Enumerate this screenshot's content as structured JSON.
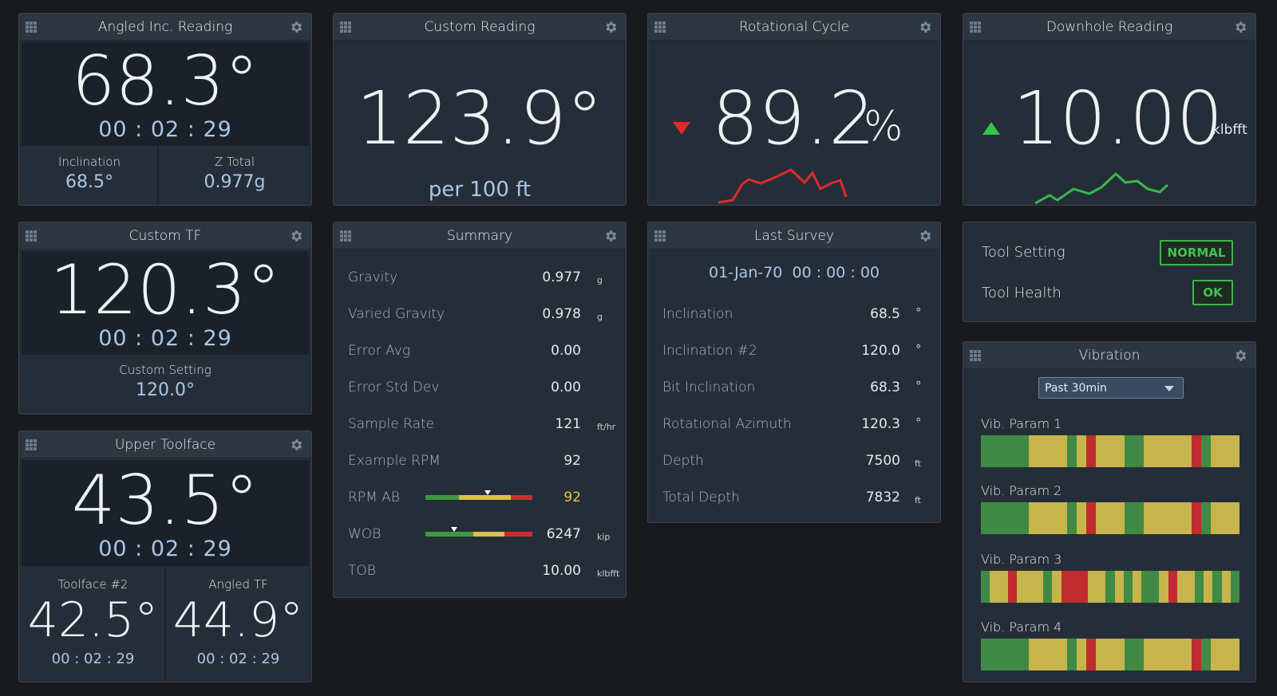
{
  "colors": {
    "green": "#3f8a45",
    "yellow": "#c8b44c",
    "red": "#c02c2f",
    "accent_timer": "#a9c6e6"
  },
  "icons": {
    "grip": "grip-icon",
    "gear": "gear-icon",
    "down": "down-triangle-icon",
    "up": "up-triangle-icon"
  },
  "angled_inc": {
    "title": "Angled Inc. Reading",
    "value": "68.3°",
    "timer": "00 : 02 : 29",
    "left_label": "Inclination",
    "left_value": "68.5°",
    "right_label": "Z Total",
    "right_value": "0.977g"
  },
  "custom_reading": {
    "title": "Custom Reading",
    "value": "123.9°",
    "unit": "per 100 ft"
  },
  "rotational": {
    "title": "Rotational Cycle",
    "value": "89.2",
    "unit": "%",
    "trend": "down"
  },
  "downhole": {
    "title": "Downhole Reading",
    "value": "10.00",
    "unit": "klbfft",
    "trend": "up"
  },
  "custom_tf": {
    "title": "Custom TF",
    "value": "120.3°",
    "timer": "00 : 02 : 29",
    "setting_label": "Custom Setting",
    "setting_value": "120.0°"
  },
  "upper_tf": {
    "title": "Upper Toolface",
    "value": "43.5°",
    "timer": "00 : 02 : 29",
    "left_label": "Toolface #2",
    "left_value": "42.5°",
    "left_timer": "00 : 02 : 29",
    "right_label": "Angled TF",
    "right_value": "44.9°",
    "right_timer": "00 : 02 : 29"
  },
  "summary": {
    "title": "Summary",
    "rows": [
      {
        "label": "Gravity",
        "value": "0.977",
        "unit": "g"
      },
      {
        "label": "Varied Gravity",
        "value": "0.978",
        "unit": "g"
      },
      {
        "label": "Error Avg",
        "value": "0.00",
        "unit": ""
      },
      {
        "label": "Error Std Dev",
        "value": "0.00",
        "unit": ""
      },
      {
        "label": "Sample Rate",
        "value": "121",
        "unit": "ft/hr"
      },
      {
        "label": "Example RPM",
        "value": "92",
        "unit": ""
      },
      {
        "label": "RPM AB",
        "value": "92",
        "unit": "",
        "gauge_level": 0.58
      },
      {
        "label": "WOB",
        "value": "6247",
        "unit": "kip",
        "gauge_level": 0.27
      },
      {
        "label": "TOB",
        "value": "10.00",
        "unit": "klbfft"
      }
    ]
  },
  "last_survey": {
    "title": "Last Survey",
    "date": "01-Jan-70",
    "time": "00 : 00 : 00",
    "rows": [
      {
        "label": "Inclination",
        "value": "68.5",
        "unit": "°"
      },
      {
        "label": "Inclination #2",
        "value": "120.0",
        "unit": "°"
      },
      {
        "label": "Bit Inclination",
        "value": "68.3",
        "unit": "°"
      },
      {
        "label": "Rotational Azimuth",
        "value": "120.3",
        "unit": "°"
      },
      {
        "label": "Depth",
        "value": "7500",
        "unit": "ft"
      },
      {
        "label": "Total Depth",
        "value": "7832",
        "unit": "ft"
      }
    ]
  },
  "tool": {
    "setting_label": "Tool Setting",
    "setting_badge": "NORMAL",
    "health_label": "Tool Health",
    "health_badge": "OK"
  },
  "vibration": {
    "title": "Vibration",
    "range": "Past 30min",
    "params": [
      {
        "label": "Vib. Param 1",
        "segments": [
          "g",
          "g",
          "g",
          "g",
          "g",
          "y",
          "y",
          "y",
          "y",
          "g",
          "y",
          "r",
          "y",
          "y",
          "y",
          "g",
          "g",
          "y",
          "y",
          "y",
          "y",
          "y",
          "r",
          "g",
          "y",
          "y",
          "y"
        ]
      },
      {
        "label": "Vib. Param 2",
        "segments": [
          "g",
          "g",
          "g",
          "g",
          "g",
          "y",
          "y",
          "y",
          "y",
          "g",
          "y",
          "r",
          "y",
          "y",
          "y",
          "g",
          "g",
          "y",
          "y",
          "y",
          "y",
          "y",
          "r",
          "g",
          "y",
          "y",
          "y"
        ]
      },
      {
        "label": "Vib. Param 3",
        "segments": [
          "g",
          "y",
          "y",
          "r",
          "y",
          "y",
          "y",
          "g",
          "y",
          "r",
          "r",
          "r",
          "y",
          "y",
          "g",
          "y",
          "g",
          "y",
          "g",
          "g",
          "y",
          "r",
          "y",
          "y",
          "g",
          "y",
          "g",
          "y",
          "g"
        ]
      },
      {
        "label": "Vib. Param 4",
        "segments": [
          "g",
          "g",
          "g",
          "g",
          "g",
          "y",
          "y",
          "y",
          "y",
          "g",
          "y",
          "r",
          "y",
          "y",
          "y",
          "g",
          "g",
          "y",
          "y",
          "y",
          "y",
          "y",
          "r",
          "g",
          "y",
          "y",
          "y"
        ]
      }
    ]
  }
}
